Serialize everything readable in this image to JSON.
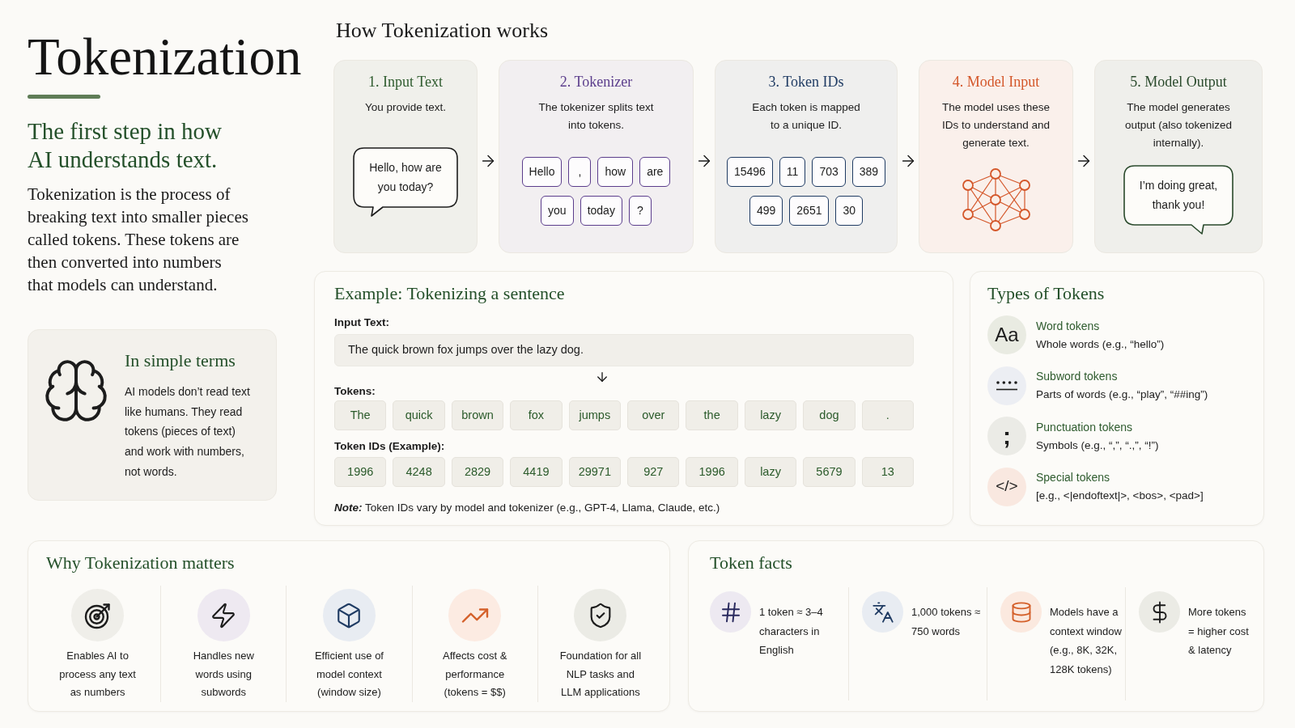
{
  "header": {
    "title": "Tokenization",
    "subtitle": "The first step in how AI understands text.",
    "intro": "Tokenization is the process of breaking text into smaller pieces called tokens. These tokens are then converted into numbers that models can understand."
  },
  "simple_terms": {
    "heading": "In simple terms",
    "text": "AI models don’t read text like humans. They read tokens (pieces of text) and work with numbers, not words."
  },
  "pipeline": {
    "heading": "How Tokenization works",
    "steps": [
      {
        "kind": "prompt",
        "title": "1. Input Text",
        "description": "You provide text.",
        "color": "#2e5b2e",
        "bubble": "Hello, how are you today?"
      },
      {
        "kind": "chips",
        "title": "2. Tokenizer",
        "description": "The tokenizer splits text into tokens.",
        "color": "#5b3d8c",
        "chips": [
          "Hello",
          ",",
          "how",
          "are",
          "you",
          "today",
          "?"
        ]
      },
      {
        "kind": "chips",
        "title": "3. Token IDs",
        "description": "Each token is mapped to a unique ID.",
        "color": "#1f3b63",
        "chips": [
          "15496",
          "11",
          "703",
          "389",
          "499",
          "2651",
          "30"
        ]
      },
      {
        "kind": "network",
        "title": "4. Model Input",
        "description": "The model uses these IDs to understand and generate text.",
        "color": "#d4572a"
      },
      {
        "kind": "reply",
        "title": "5. Model Output",
        "description": "The model generates output (also tokenized internally).",
        "color": "#2a4a2c",
        "bubble": "I’m doing great, thank you!"
      }
    ]
  },
  "example": {
    "heading": "Example: Tokenizing a sentence",
    "input_label": "Input Text:",
    "input_value": "The quick brown fox jumps over the lazy dog.",
    "tokens_label": "Tokens:",
    "tokens": [
      "The",
      "quick",
      "brown",
      "fox",
      "jumps",
      "over",
      "the",
      "lazy",
      "dog",
      "."
    ],
    "ids_label": "Token IDs (Example):",
    "ids": [
      "1996",
      "4248",
      "2829",
      "4419",
      "29971",
      "927",
      "1996",
      "lazy",
      "5679",
      "13"
    ],
    "note_label": "Note:",
    "note": "Token IDs vary by model and tokenizer (e.g., GPT-4, Llama, Claude, etc.)"
  },
  "token_types": {
    "heading": "Types of Tokens",
    "items": [
      {
        "kind": "letters",
        "glyph": "Aa",
        "title": "Word tokens",
        "description": "Whole words (e.g., “hello”)"
      },
      {
        "kind": "dots",
        "title": "Subword tokens",
        "description": "Parts of words (e.g., “play”, “##ing”)"
      },
      {
        "kind": "punctuation",
        "glyph": ";",
        "title": "Punctuation tokens",
        "description": "Symbols (e.g., “,”, “.,”, “!”)"
      },
      {
        "kind": "code",
        "glyph": "</>",
        "title": "Special tokens",
        "description": "[e.g., <|endoftext|>, <bos>, <pad>]"
      }
    ]
  },
  "why_matters": {
    "heading": "Why Tokenization matters",
    "items": [
      {
        "text": "Enables AI to process any text as numbers"
      },
      {
        "text": "Handles new words using subwords"
      },
      {
        "text": "Efficient use of model context (window size)"
      },
      {
        "text": "Affects cost & performance (tokens = $$)"
      },
      {
        "text": "Foundation for all NLP tasks and LLM applications"
      }
    ]
  },
  "token_facts": {
    "heading": "Token facts",
    "items": [
      {
        "text": "1 token ≈ 3–4 characters in English"
      },
      {
        "text": "1,000 tokens ≈ 750 words"
      },
      {
        "text": "Models have a context window (e.g., 8K, 32K, 128K tokens)"
      },
      {
        "text": "More tokens = higher cost & latency"
      }
    ]
  }
}
